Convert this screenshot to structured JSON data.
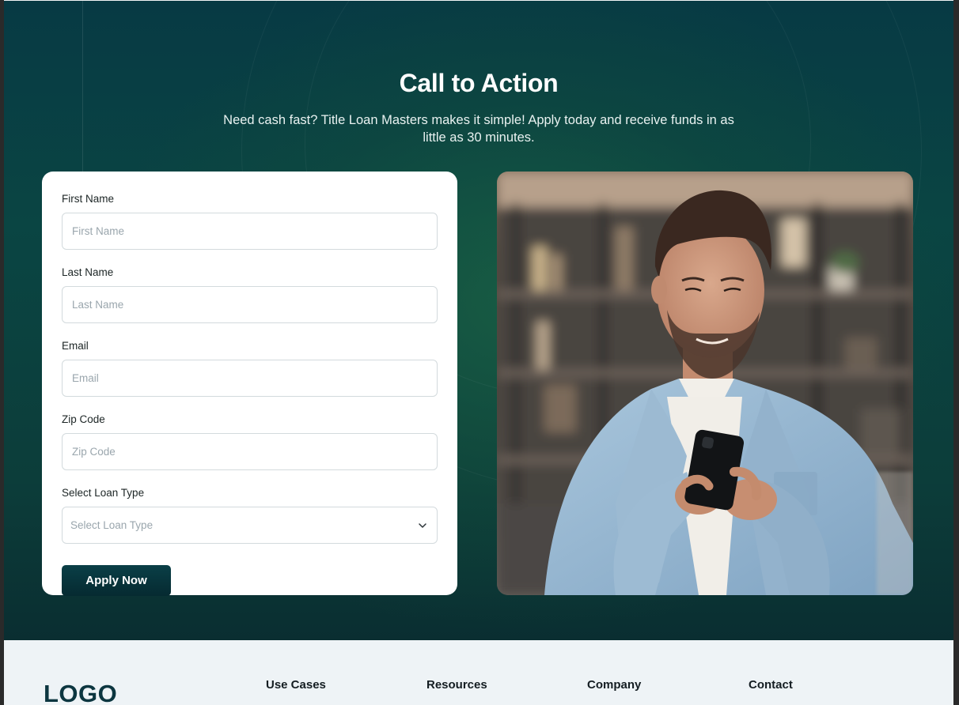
{
  "hero": {
    "title": "Call to Action",
    "subtitle": "Need cash fast? Title Loan Masters makes it simple! Apply today and receive funds in as little as 30 minutes."
  },
  "form": {
    "fields": [
      {
        "label": "First Name",
        "placeholder": "First Name"
      },
      {
        "label": "Last Name",
        "placeholder": "Last Name"
      },
      {
        "label": "Email",
        "placeholder": "Email"
      },
      {
        "label": "Zip Code",
        "placeholder": "Zip Code"
      }
    ],
    "loan_type": {
      "label": "Select Loan Type",
      "placeholder": "Select Loan Type",
      "icon": "chevron-down-icon"
    },
    "submit_label": "Apply Now"
  },
  "image": {
    "subject": "man-smiling-using-smartphone-photo"
  },
  "footer": {
    "logo": "LOGO",
    "columns": [
      "Use Cases",
      "Resources",
      "Company",
      "Contact"
    ]
  },
  "colors": {
    "hero_bg": "#0a4543",
    "button_bg": "#0a3f47",
    "logo": "#0c3640",
    "footer_bg": "#eef3f6"
  }
}
